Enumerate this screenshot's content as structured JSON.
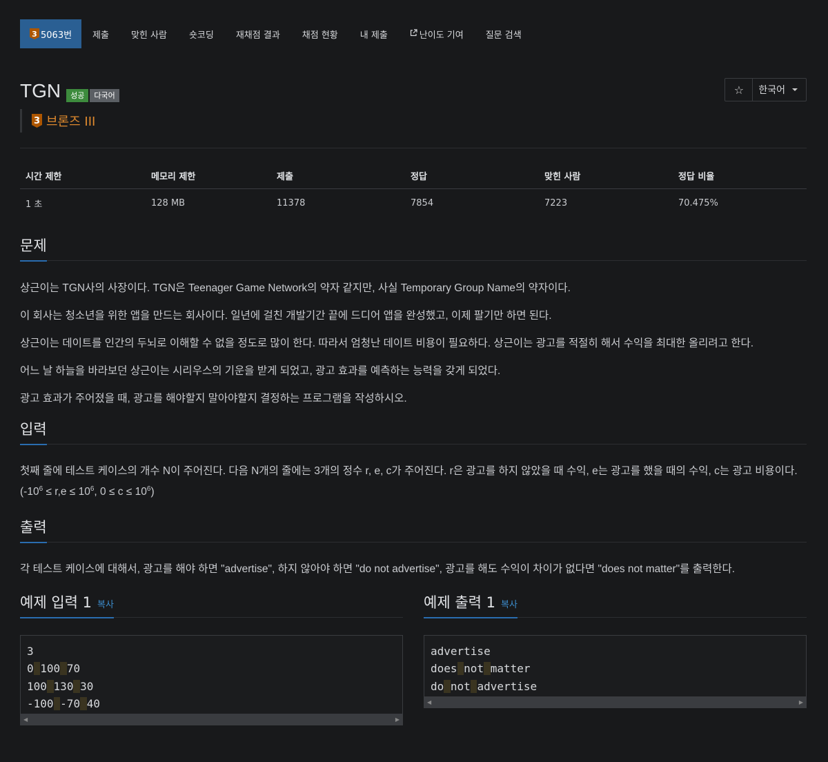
{
  "tabs": [
    {
      "label": "5063번",
      "badge": "3",
      "active": true
    },
    {
      "label": "제출"
    },
    {
      "label": "맞힌 사람"
    },
    {
      "label": "숏코딩"
    },
    {
      "label": "재채점 결과"
    },
    {
      "label": "채점 현황"
    },
    {
      "label": "내 제출"
    },
    {
      "label": "난이도 기여",
      "icon": "external-link-icon"
    },
    {
      "label": "질문 검색"
    }
  ],
  "problem": {
    "title": "TGN",
    "labels": {
      "success": "성공",
      "multi": "다국어"
    },
    "tier_badge": "3",
    "tier": "브론즈 III",
    "star_icon": "☆",
    "language": "한국어"
  },
  "stats": {
    "headers": [
      "시간 제한",
      "메모리 제한",
      "제출",
      "정답",
      "맞힌 사람",
      "정답 비율"
    ],
    "values": [
      "1 초",
      "128 MB",
      "11378",
      "7854",
      "7223",
      "70.475%"
    ]
  },
  "sections": {
    "problem_title": "문제",
    "problem_paragraphs": [
      "상근이는 TGN사의 사장이다. TGN은 Teenager Game Network의 약자 같지만, 사실 Temporary Group Name의 약자이다.",
      "이 회사는 청소년을 위한 앱을 만드는 회사이다. 일년에 걸친 개발기간 끝에 드디어 앱을 완성했고, 이제 팔기만 하면 된다.",
      "상근이는 데이트를 인간의 두뇌로 이해할 수 없을 정도로 많이 한다. 따라서 엄청난 데이트 비용이 필요하다. 상근이는 광고를 적절히 해서 수익을 최대한 올리려고 한다.",
      "어느 날 하늘을 바라보던 상근이는 시리우스의 기운을 받게 되었고, 광고 효과를 예측하는 능력을 갖게 되었다.",
      "광고 효과가 주어졌을 때, 광고를 해야할지 말아야할지 결정하는 프로그램을 작성하시오."
    ],
    "input_title": "입력",
    "input_text": "첫째 줄에 테스트 케이스의 개수 N이 주어진다. 다음 N개의 줄에는 3개의 정수 r, e, c가 주어진다. r은 광고를 하지 않았을 때 수익, e는 광고를 했을 때의 수익, c는 광고 비용이다. (-10",
    "input_sup1": "6",
    "input_mid1": " ≤ r,e ≤ 10",
    "input_sup2": "6",
    "input_mid2": ", 0 ≤ c ≤ 10",
    "input_sup3": "6",
    "input_end": ")",
    "output_title": "출력",
    "output_text": "각 테스트 케이스에 대해서, 광고를 해야 하면 \"advertise\", 하지 않아야 하면 \"do not advertise\", 광고를 해도 수익이 차이가 없다면 \"does not matter\"를 출력한다."
  },
  "samples": {
    "input_title": "예제 입력 1",
    "output_title": "예제 출력 1",
    "copy_label": "복사",
    "input_lines": [
      [
        "3"
      ],
      [
        "0",
        "100",
        "70"
      ],
      [
        "100",
        "130",
        "30"
      ],
      [
        "-100",
        "-70",
        "40"
      ]
    ],
    "output_lines": [
      [
        "advertise"
      ],
      [
        "does",
        "not",
        "matter"
      ],
      [
        "do",
        "not",
        "advertise"
      ]
    ]
  }
}
